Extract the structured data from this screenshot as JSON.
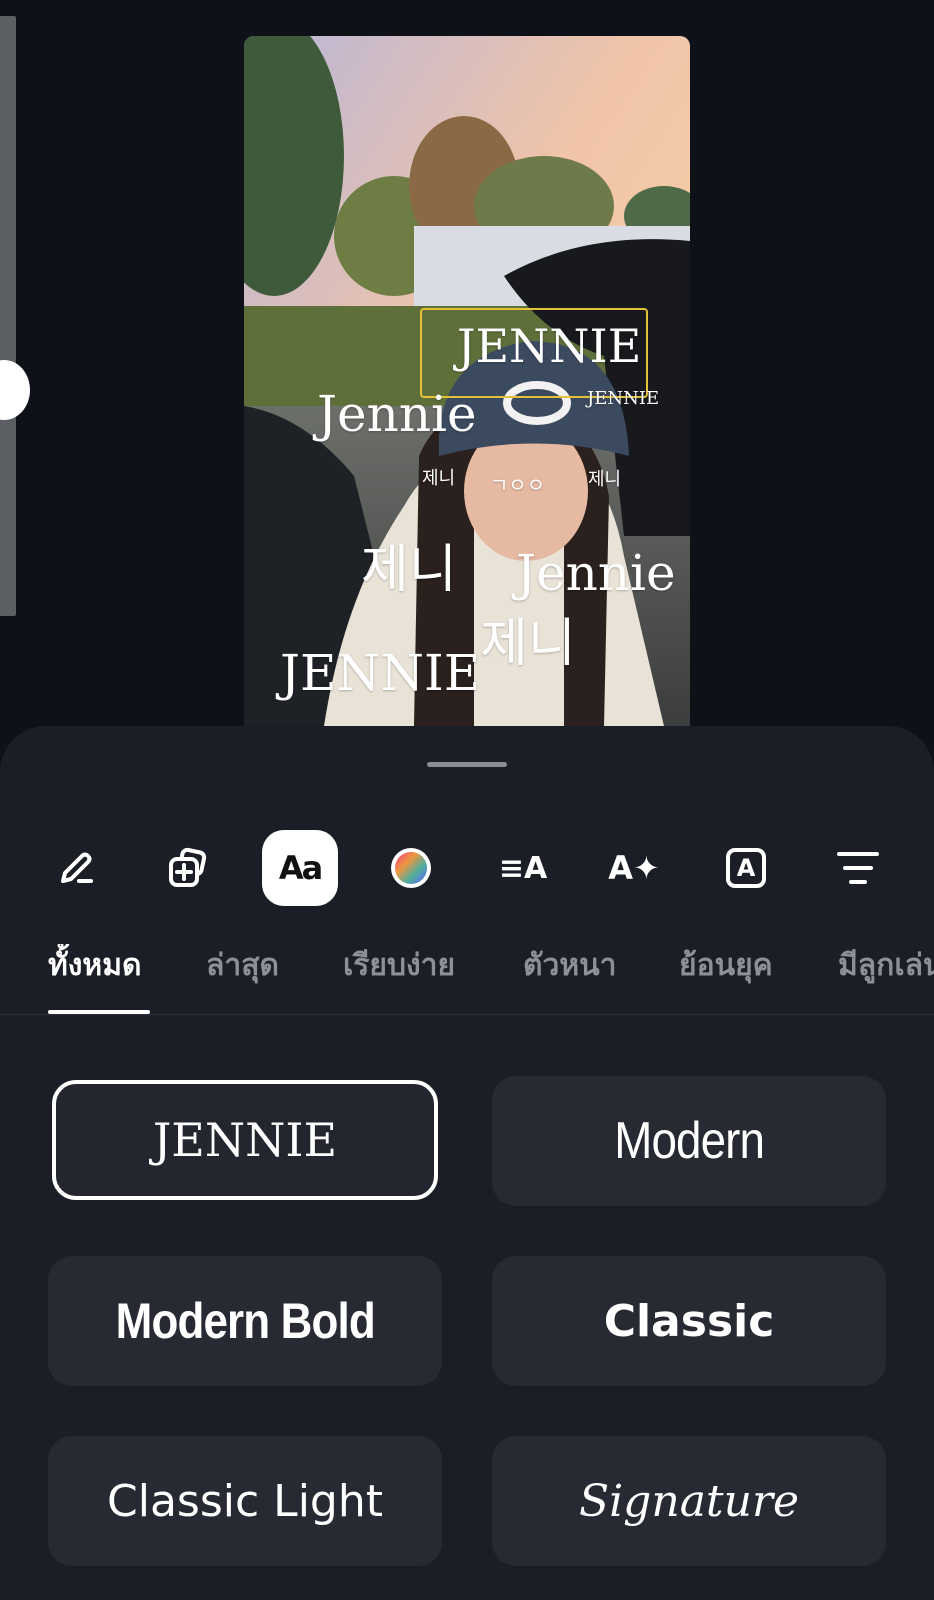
{
  "canvas": {
    "overlays": [
      {
        "id": "jennie-caps-selected",
        "text": "JENNIE"
      },
      {
        "id": "jennie-large",
        "text": "Jennie"
      },
      {
        "id": "jennie-caps-small",
        "text": "JENNIE"
      },
      {
        "id": "jeni-small-left",
        "text": "제니"
      },
      {
        "id": "jeni-small-mid",
        "text": "ㄱㅇㅇ"
      },
      {
        "id": "jeni-small-right",
        "text": "제니"
      },
      {
        "id": "jeni-large-left",
        "text": "제니"
      },
      {
        "id": "jennie-large-right",
        "text": "Jennie"
      },
      {
        "id": "jeni-large-bottom",
        "text": "제니"
      },
      {
        "id": "jennie-caps-bottom",
        "text": "JENNIE"
      }
    ]
  },
  "toolbar": {
    "tools": [
      {
        "name": "pencil-icon"
      },
      {
        "name": "add-sticker-icon"
      },
      {
        "name": "font-icon",
        "label": "Aa",
        "active": true
      },
      {
        "name": "color-wheel-icon"
      },
      {
        "name": "text-align-icon",
        "label": "≡A"
      },
      {
        "name": "text-effect-icon",
        "label": "A✦"
      },
      {
        "name": "text-background-icon",
        "label": "A"
      },
      {
        "name": "filter-lines-icon"
      }
    ]
  },
  "tabs": [
    "ทั้งหมด",
    "ล่าสุด",
    "เรียบง่าย",
    "ตัวหนา",
    "ย้อนยุค",
    "มีลูกเล่น"
  ],
  "active_tab": 0,
  "fonts": [
    {
      "label": "JENNIE",
      "selected": true
    },
    {
      "label": "Modern"
    },
    {
      "label": "Modern Bold"
    },
    {
      "label": "Classic"
    },
    {
      "label": "Classic Light"
    },
    {
      "label": "Signature"
    }
  ],
  "colors": {
    "background": "#0e1117",
    "sheet": "#1b1e26",
    "card": "#272a33",
    "selection_outline": "#e5c13a"
  }
}
